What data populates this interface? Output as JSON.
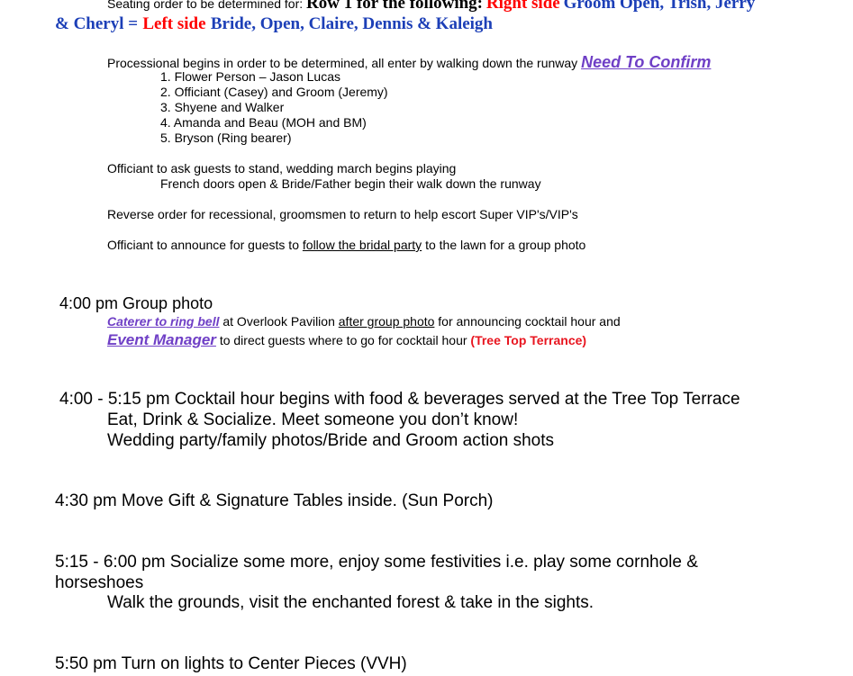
{
  "seating": {
    "intro": "Seating order to be determined for:",
    "row1": "Row 1 for the following:",
    "right_side": "Right side",
    "right_names": "Groom Open, Trish, Jerry",
    "line2_prefix": "& Cheryl =",
    "left_side": "Left side",
    "left_names": "Bride, Open, Claire, Dennis & Kaleigh"
  },
  "processional": {
    "intro": "Processional begins in order to be determined, all enter by walking down the runway",
    "need_confirm": "Need To Confirm",
    "order": [
      "1. Flower Person – Jason Lucas",
      "2. Officiant (Casey) and Groom (Jeremy)",
      "3. Shyene and Walker",
      "4. Amanda and Beau (MOH and BM)",
      "5. Bryson  (Ring bearer)"
    ],
    "stand": "Officiant to ask guests to stand, wedding march begins playing",
    "french_doors": "French doors open & Bride/Father begin their walk down the runway",
    "recessional": "Reverse order for recessional, groomsmen to return to help escort Super VIP's/VIP's",
    "announce_prefix": "Officiant to announce for guests to",
    "announce_link": "follow the bridal party",
    "announce_suffix": "to the lawn for a group photo"
  },
  "group_photo": {
    "title": "4:00 pm Group photo",
    "caterer": "Caterer to ring bell",
    "caterer_mid": "at Overlook Pavilion",
    "after_photo": "after group photo",
    "caterer_end": "for announcing cocktail hour and",
    "event_manager": "Event Manager",
    "em_text": "to direct guests where to go for cocktail hour",
    "tree_top": "(Tree Top Terrance)"
  },
  "cocktail": {
    "title": "4:00 - 5:15 pm Cocktail hour begins with food & beverages served at the Tree Top Terrace",
    "line2": "Eat, Drink & Socialize. Meet someone you don’t know!",
    "line3": "Wedding party/family photos/Bride and Groom action shots"
  },
  "gift_tables": {
    "title": "4:30 pm  Move Gift & Signature Tables inside. (Sun Porch)"
  },
  "socialize": {
    "title": "5:15 - 6:00 pm Socialize some more, enjoy some festivities i.e. play some cornhole &",
    "title_cont": "horseshoes",
    "line2": "Walk the grounds, visit the enchanted forest & take in the sights."
  },
  "lights": {
    "title": "5:50 pm Turn on lights to Center Pieces (VVH)"
  }
}
